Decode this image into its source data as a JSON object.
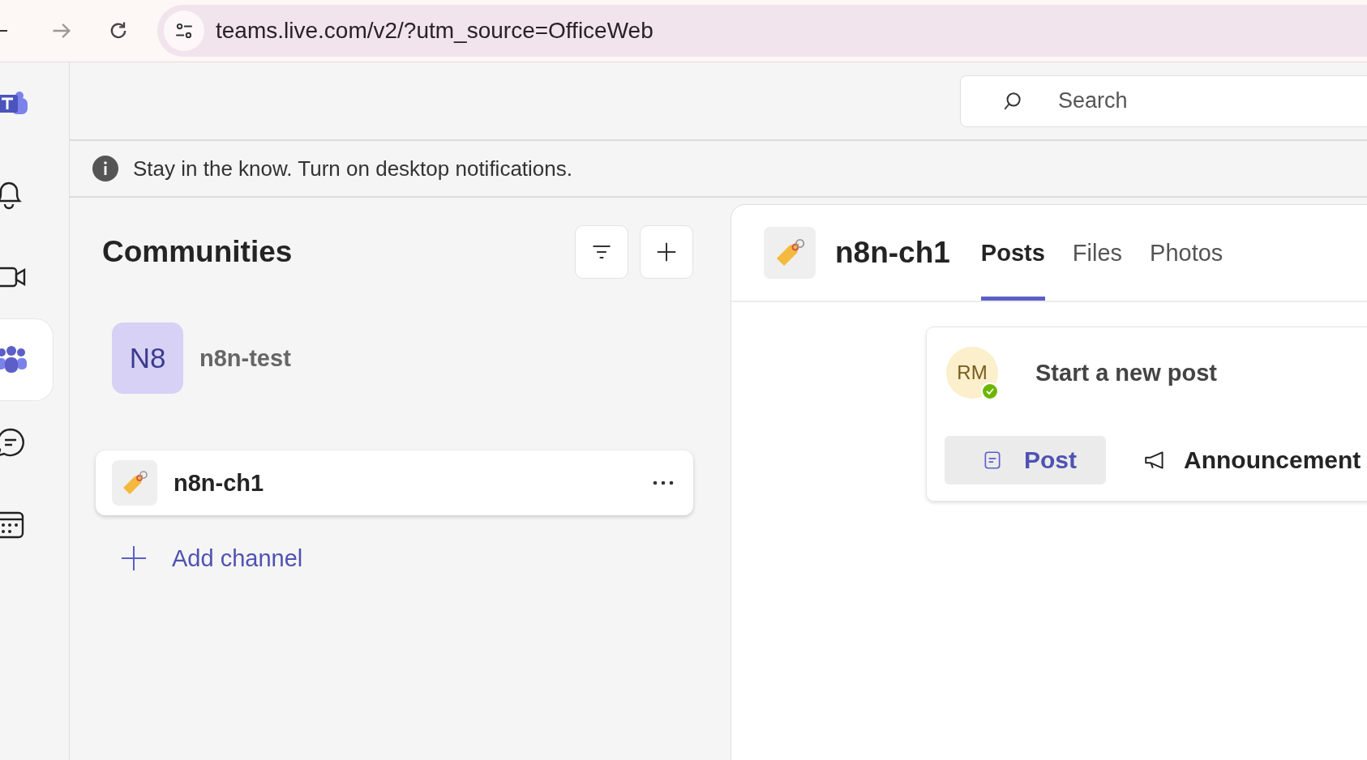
{
  "browser": {
    "url": "teams.live.com/v2/?utm_source=OfficeWeb"
  },
  "rail": [
    {
      "kind": "bell",
      "selected": false
    },
    {
      "kind": "video",
      "selected": false
    },
    {
      "kind": "communities",
      "selected": true
    },
    {
      "kind": "chat",
      "selected": false
    },
    {
      "kind": "calendar",
      "selected": false
    }
  ],
  "search": {
    "placeholder": "Search"
  },
  "notice": {
    "text": "Stay in the know. Turn on desktop notifications."
  },
  "communities": {
    "title": "Communities",
    "items": [
      {
        "initials": "N8",
        "name": "n8n-test"
      }
    ],
    "channels": [
      {
        "name": "n8n-ch1",
        "selected": true
      }
    ],
    "add_channel": "Add channel"
  },
  "channel": {
    "name": "n8n-ch1",
    "tabs": [
      {
        "label": "Posts",
        "selected": true
      },
      {
        "label": "Files",
        "selected": false
      },
      {
        "label": "Photos",
        "selected": false
      }
    ],
    "composer": {
      "avatar": "RM",
      "available": true,
      "prompt": "Start a new post",
      "post_types": [
        {
          "kind": "post",
          "label": "Post",
          "selected": true
        },
        {
          "kind": "announcement",
          "label": "Announcement",
          "selected": false
        }
      ]
    }
  }
}
